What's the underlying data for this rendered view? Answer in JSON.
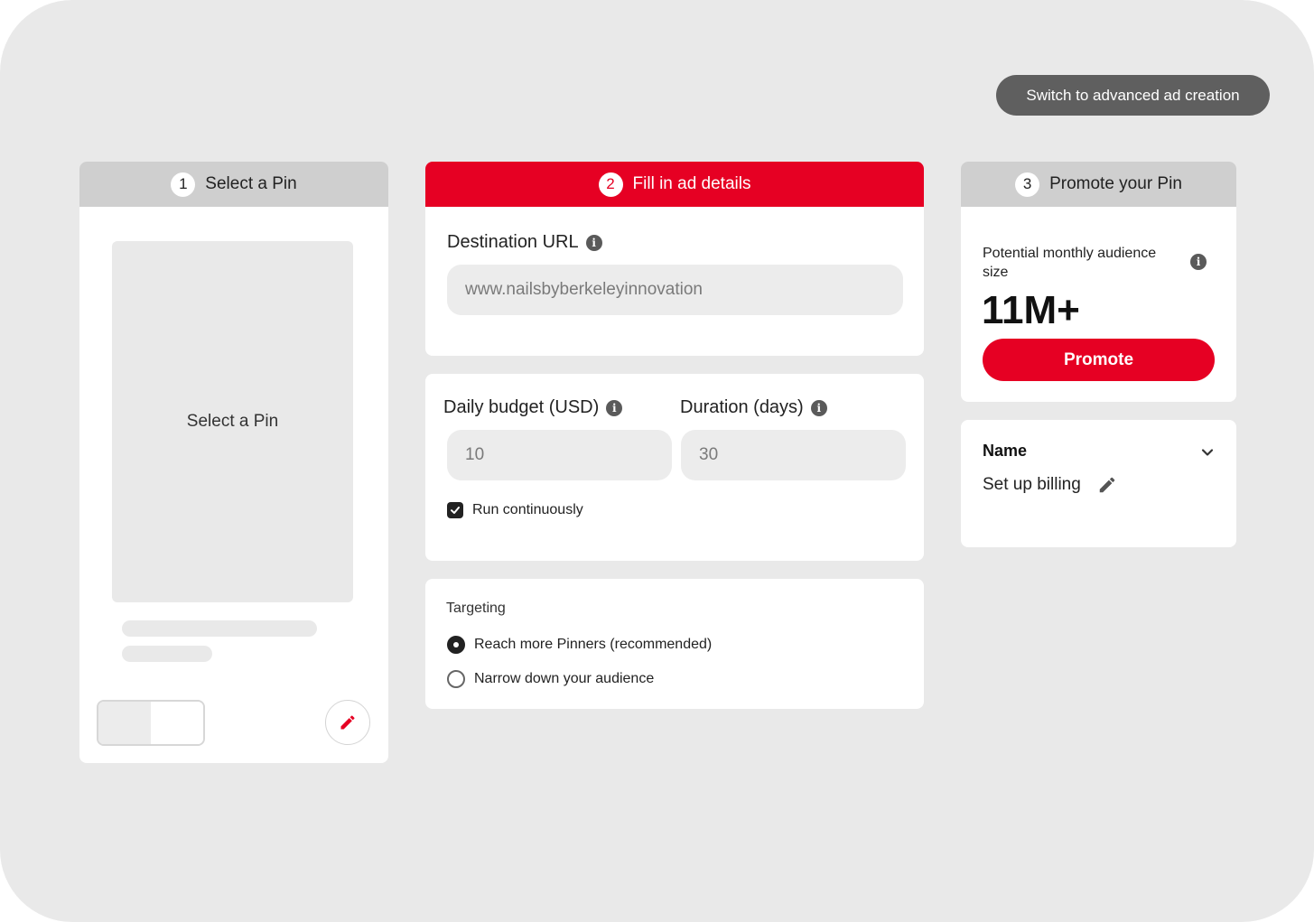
{
  "header": {
    "advanced_button_label": "Switch to advanced ad creation"
  },
  "steps": [
    {
      "number": "1",
      "title": "Select a Pin"
    },
    {
      "number": "2",
      "title": "Fill in ad details"
    },
    {
      "number": "3",
      "title": "Promote your Pin"
    }
  ],
  "select_pin": {
    "placeholder_label": "Select a Pin"
  },
  "ad_details": {
    "destination_url_label": "Destination URL",
    "destination_url_placeholder": "www.nailsbyberkeleyinnovation",
    "daily_budget_label": "Daily budget (USD)",
    "daily_budget_placeholder": "10",
    "duration_label": "Duration (days)",
    "duration_placeholder": "30",
    "run_continuously_label": "Run continuously",
    "run_continuously_checked": true,
    "targeting_label": "Targeting",
    "targeting_options": [
      {
        "label": "Reach more Pinners (recommended)",
        "selected": true
      },
      {
        "label": "Narrow down your audience",
        "selected": false
      }
    ]
  },
  "promote": {
    "audience_label": "Potential monthly audience size",
    "audience_value": "11M+",
    "promote_button_label": "Promote",
    "name_label": "Name",
    "billing_label": "Set up billing"
  },
  "colors": {
    "brand_red": "#e60023",
    "dark_button": "#5f5f5f",
    "step_header_grey": "#cfcfcf"
  }
}
